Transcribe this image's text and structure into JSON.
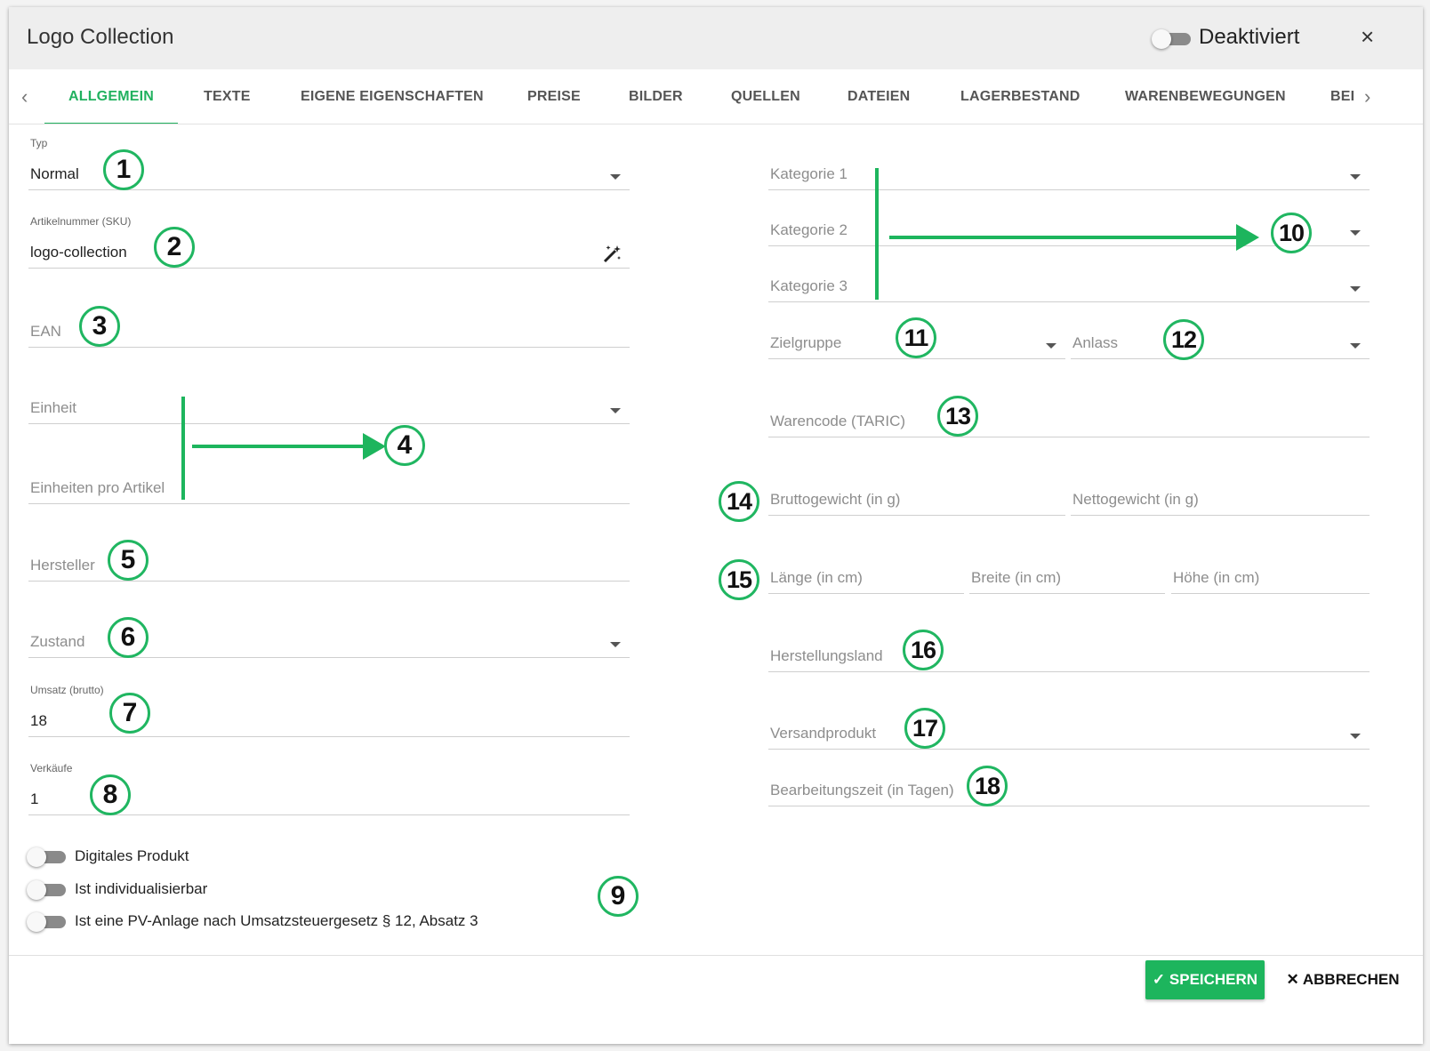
{
  "header": {
    "title": "Logo Collection",
    "status_label": "Deaktiviert",
    "close_label": "×"
  },
  "tabs": [
    {
      "label": "ALLGEMEIN",
      "active": true
    },
    {
      "label": "TEXTE"
    },
    {
      "label": "EIGENE EIGENSCHAFTEN"
    },
    {
      "label": "PREISE"
    },
    {
      "label": "BILDER"
    },
    {
      "label": "QUELLEN"
    },
    {
      "label": "DATEIEN"
    },
    {
      "label": "LAGERBESTAND"
    },
    {
      "label": "WARENBEWEGUNGEN"
    },
    {
      "label": "BEI"
    }
  ],
  "left": {
    "typ": {
      "label": "Typ",
      "value": "Normal"
    },
    "sku": {
      "label": "Artikelnummer (SKU)",
      "value": "logo-collection"
    },
    "ean": {
      "placeholder": "EAN"
    },
    "einheit": {
      "placeholder": "Einheit"
    },
    "einheiten_pro_artikel": {
      "placeholder": "Einheiten pro Artikel"
    },
    "hersteller": {
      "placeholder": "Hersteller"
    },
    "zustand": {
      "placeholder": "Zustand"
    },
    "umsatz": {
      "label": "Umsatz (brutto)",
      "value": "18"
    },
    "verkaeufe": {
      "label": "Verkäufe",
      "value": "1"
    },
    "switches": [
      {
        "label": "Digitales Produkt",
        "on": false
      },
      {
        "label": "Ist individualisierbar",
        "on": false
      },
      {
        "label": "Ist eine PV-Anlage nach Umsatzsteuergesetz § 12, Absatz 3",
        "on": false
      }
    ]
  },
  "right": {
    "kategorie1": {
      "placeholder": "Kategorie 1"
    },
    "kategorie2": {
      "placeholder": "Kategorie 2"
    },
    "kategorie3": {
      "placeholder": "Kategorie 3"
    },
    "zielgruppe": {
      "placeholder": "Zielgruppe"
    },
    "anlass": {
      "placeholder": "Anlass"
    },
    "warencode": {
      "placeholder": "Warencode (TARIC)"
    },
    "bruttogewicht": {
      "placeholder": "Bruttogewicht (in g)"
    },
    "nettogewicht": {
      "placeholder": "Nettogewicht (in g)"
    },
    "laenge": {
      "placeholder": "Länge (in cm)"
    },
    "breite": {
      "placeholder": "Breite (in cm)"
    },
    "hoehe": {
      "placeholder": "Höhe (in cm)"
    },
    "herstellungsland": {
      "placeholder": "Herstellungsland"
    },
    "versandprodukt": {
      "placeholder": "Versandprodukt"
    },
    "bearbeitungszeit": {
      "placeholder": "Bearbeitungszeit (in Tagen)"
    }
  },
  "annotations": [
    "1",
    "2",
    "3",
    "4",
    "5",
    "6",
    "7",
    "8",
    "9",
    "10",
    "11",
    "12",
    "13",
    "14",
    "15",
    "16",
    "17",
    "18"
  ],
  "footer": {
    "save_label": "SPEICHERN",
    "cancel_label": "ABBRECHEN"
  },
  "colors": {
    "accent": "#21b15f",
    "annotation_green": "#20b661"
  }
}
